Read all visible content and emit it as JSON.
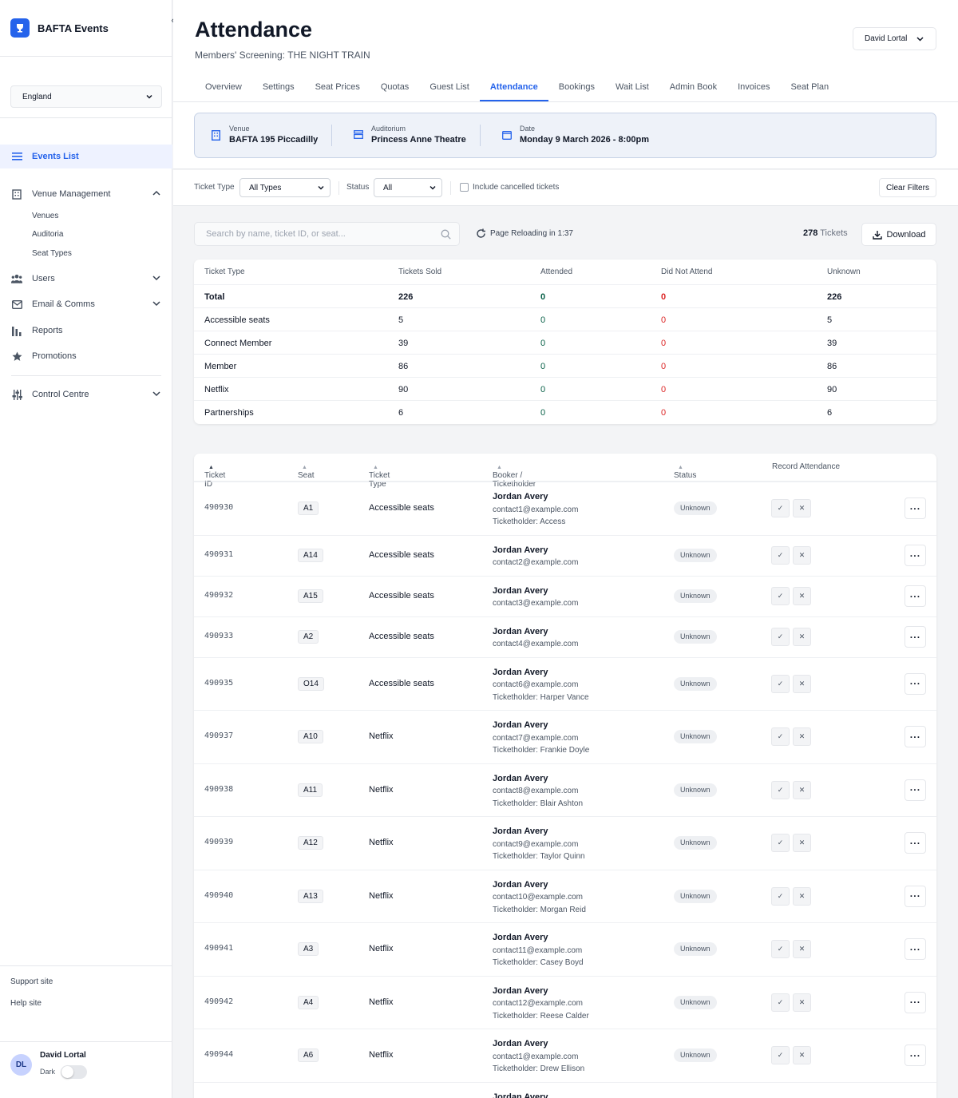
{
  "app": {
    "name": "BAFTA Events",
    "collapse_glyph": "‹"
  },
  "sidebar": {
    "region": "England",
    "events_list": "Events List",
    "venue_management": "Venue Management",
    "venue_sub": [
      "Venues",
      "Auditoria",
      "Seat Types"
    ],
    "users": "Users",
    "email_comms": "Email & Comms",
    "reports": "Reports",
    "promotions": "Promotions",
    "control_centre": "Control Centre",
    "support_site": "Support site",
    "help_site": "Help site",
    "user_initials": "DL",
    "user_name": "David Lortal",
    "mode_label": "Dark"
  },
  "header": {
    "title": "Attendance",
    "subtitle": "Members' Screening: THE NIGHT TRAIN",
    "user_menu": "David Lortal",
    "tabs": [
      "Overview",
      "Settings",
      "Seat Prices",
      "Quotas",
      "Guest List",
      "Attendance",
      "Bookings",
      "Wait List",
      "Admin Book",
      "Invoices",
      "Seat Plan"
    ],
    "active_tab": "Attendance"
  },
  "info": {
    "venue_label": "Venue",
    "venue_value": "BAFTA 195 Piccadilly",
    "auditorium_label": "Auditorium",
    "auditorium_value": "Princess Anne Theatre",
    "date_label": "Date",
    "date_value": "Monday 9 March 2026 - 8:00pm"
  },
  "filters": {
    "ticket_type_label": "Ticket Type",
    "ticket_type_value": "All Types",
    "status_label": "Status",
    "status_value": "All",
    "include_cancelled_label": "Include cancelled tickets",
    "clear_label": "Clear Filters"
  },
  "toolbar": {
    "search_placeholder": "Search by name, ticket ID, or seat...",
    "reload_text": "Page Reloading in 1:37",
    "ticket_count": "278",
    "ticket_count_label": "Tickets",
    "download_label": "Download"
  },
  "summary": {
    "headers": [
      "Ticket Type",
      "Tickets Sold",
      "Attended",
      "Did Not Attend",
      "Unknown"
    ],
    "rows": [
      [
        "Total",
        "226",
        "0",
        "0",
        "226"
      ],
      [
        "Accessible seats",
        "5",
        "0",
        "0",
        "5"
      ],
      [
        "Connect Member",
        "39",
        "0",
        "0",
        "39"
      ],
      [
        "Member",
        "86",
        "0",
        "0",
        "86"
      ],
      [
        "Netflix",
        "90",
        "0",
        "0",
        "90"
      ],
      [
        "Partnerships",
        "6",
        "0",
        "0",
        "6"
      ]
    ]
  },
  "tickets": {
    "headers": [
      "Ticket ID",
      "Seat",
      "Ticket Type",
      "Booker / Ticketholder",
      "Status",
      "Record Attendance"
    ],
    "sort_active": "▲",
    "sort_idle": "▲",
    "attend_glyph": "✓",
    "absent_glyph": "✕",
    "more_glyph": "···",
    "rows": [
      {
        "id": "490930",
        "seat": "A1",
        "type": "Accessible seats",
        "name": "Jordan Avery",
        "email": "contact1@example.com",
        "holder": "Ticketholder: Access",
        "status": "Unknown"
      },
      {
        "id": "490931",
        "seat": "A14",
        "type": "Accessible seats",
        "name": "Jordan Avery",
        "email": "contact2@example.com",
        "holder": "",
        "status": "Unknown"
      },
      {
        "id": "490932",
        "seat": "A15",
        "type": "Accessible seats",
        "name": "Jordan Avery",
        "email": "contact3@example.com",
        "holder": "",
        "status": "Unknown"
      },
      {
        "id": "490933",
        "seat": "A2",
        "type": "Accessible seats",
        "name": "Jordan Avery",
        "email": "contact4@example.com",
        "holder": "",
        "status": "Unknown"
      },
      {
        "id": "490935",
        "seat": "O14",
        "type": "Accessible seats",
        "name": "Jordan Avery",
        "email": "contact6@example.com",
        "holder": "Ticketholder: Harper Vance",
        "status": "Unknown"
      },
      {
        "id": "490937",
        "seat": "A10",
        "type": "Netflix",
        "name": "Jordan Avery",
        "email": "contact7@example.com",
        "holder": "Ticketholder: Frankie Doyle",
        "status": "Unknown"
      },
      {
        "id": "490938",
        "seat": "A11",
        "type": "Netflix",
        "name": "Jordan Avery",
        "email": "contact8@example.com",
        "holder": "Ticketholder: Blair Ashton",
        "status": "Unknown"
      },
      {
        "id": "490939",
        "seat": "A12",
        "type": "Netflix",
        "name": "Jordan Avery",
        "email": "contact9@example.com",
        "holder": "Ticketholder: Taylor Quinn",
        "status": "Unknown"
      },
      {
        "id": "490940",
        "seat": "A13",
        "type": "Netflix",
        "name": "Jordan Avery",
        "email": "contact10@example.com",
        "holder": "Ticketholder: Morgan Reid",
        "status": "Unknown"
      },
      {
        "id": "490941",
        "seat": "A3",
        "type": "Netflix",
        "name": "Jordan Avery",
        "email": "contact11@example.com",
        "holder": "Ticketholder: Casey Boyd",
        "status": "Unknown"
      },
      {
        "id": "490942",
        "seat": "A4",
        "type": "Netflix",
        "name": "Jordan Avery",
        "email": "contact12@example.com",
        "holder": "Ticketholder: Reese Calder",
        "status": "Unknown"
      },
      {
        "id": "490944",
        "seat": "A6",
        "type": "Netflix",
        "name": "Jordan Avery",
        "email": "contact1@example.com",
        "holder": "Ticketholder: Drew Ellison",
        "status": "Unknown"
      },
      {
        "id": "",
        "seat": "",
        "type": "",
        "name": "Jordan Avery",
        "email": "",
        "holder": "",
        "status": ""
      }
    ]
  },
  "colors": {
    "accent": "#2563eb",
    "danger": "#dc2626",
    "attended": "#065f46"
  }
}
